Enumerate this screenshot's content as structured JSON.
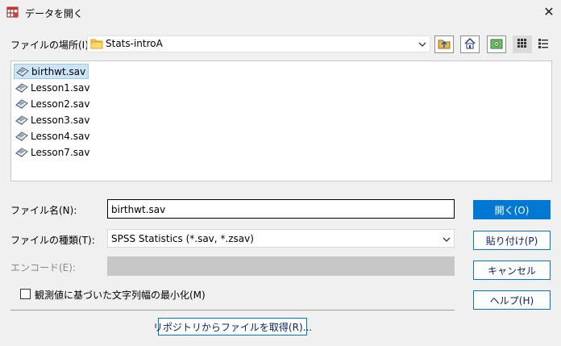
{
  "window": {
    "title": "データを開く",
    "app_icon": "spss-data-icon",
    "close_glyph": "✕"
  },
  "look_in": {
    "label": "ファイルの場所(I):",
    "value": "Stats-introA",
    "icon": "folder-icon"
  },
  "toolbar": {
    "buttons": [
      "up-folder-icon",
      "home-icon",
      "new-folder-icon",
      "list-view-icon",
      "details-view-icon"
    ]
  },
  "files": [
    "birthwt.sav",
    "Lesson1.sav",
    "Lesson2.sav",
    "Lesson3.sav",
    "Lesson4.sav",
    "Lesson7.sav"
  ],
  "selected_file_index": 0,
  "form": {
    "filename_label": "ファイル名(N):",
    "filename_value": "birthwt.sav",
    "filetype_label": "ファイルの種類(T):",
    "filetype_value": "SPSS Statistics (*.sav, *.zsav)",
    "encoding_label": "エンコード(E):",
    "encoding_value": ""
  },
  "checkbox": {
    "label": "観測値に基づいた文字列幅の最小化(M)",
    "checked": false
  },
  "buttons": {
    "open": "開く(O)",
    "paste": "貼り付け(P)",
    "cancel": "キャンセル",
    "help": "ヘルプ(H)",
    "repository": "リポジトリからファイルを取得(R)..."
  },
  "colors": {
    "accent": "#0078d4",
    "selection": "#cce4f7",
    "disabled": "#c7c7c7",
    "background": "#f0f0f0"
  }
}
